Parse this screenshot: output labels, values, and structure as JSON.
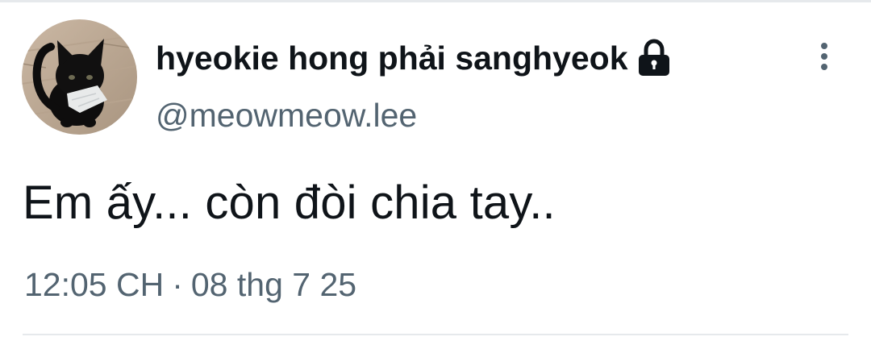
{
  "user": {
    "display_name": "hyeokie hong phải sanghyeok",
    "handle": "@meowmeow.lee",
    "protected_icon": "lock-icon",
    "avatar": "black-cat-avatar"
  },
  "menu": {
    "icon": "more-vertical-icon"
  },
  "tweet": {
    "text": "Em ấy... còn đòi chia tay..",
    "time": "12:05 CH",
    "separator": "·",
    "date": "08 thg 7 25"
  },
  "colors": {
    "primary_text": "#0f1419",
    "secondary_text": "#536471",
    "divider": "#e6e9ec"
  }
}
